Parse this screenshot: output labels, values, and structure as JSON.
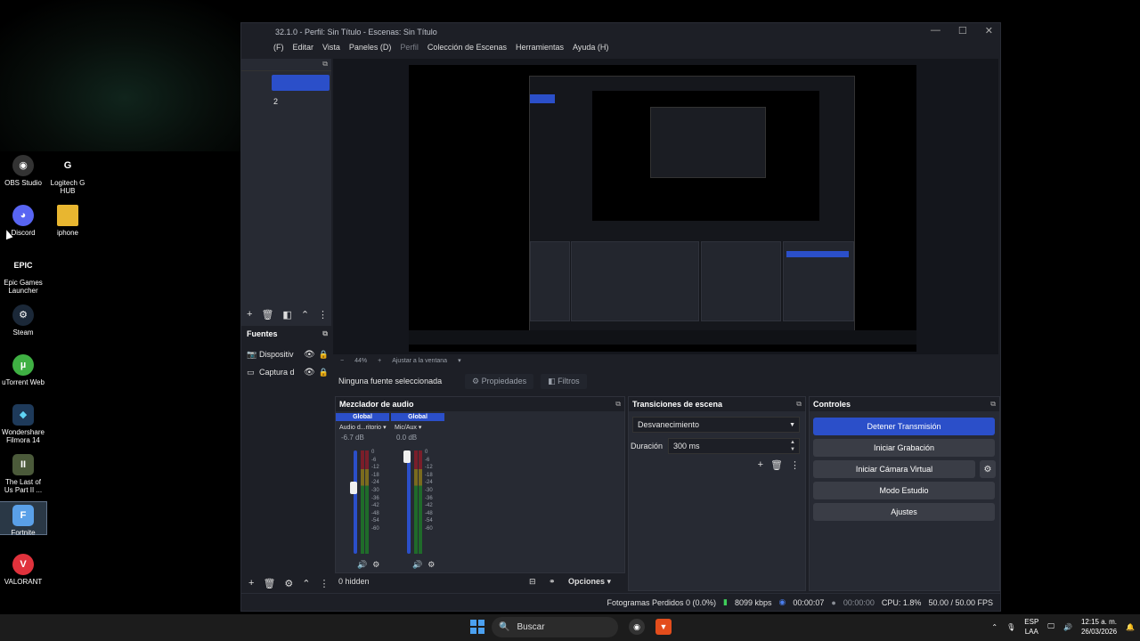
{
  "desktop": {
    "icons": [
      {
        "label": "OBS Studio"
      },
      {
        "label": "Logitech G HUB"
      },
      {
        "label": "Discord"
      },
      {
        "label": "iphone"
      },
      {
        "label": "Epic Games Launcher"
      },
      {
        "label": "Steam"
      },
      {
        "label": "uTorrent Web"
      },
      {
        "label": "Wondershare Filmora 14"
      },
      {
        "label": "The Last of Us Part II ..."
      },
      {
        "label": "Fortnite"
      },
      {
        "label": "VALORANT"
      }
    ]
  },
  "obs": {
    "title": "32.1.0 - Perfil: Sin Título - Escenas: Sin Título",
    "menu": [
      "(F)",
      "Editar",
      "Vista",
      "Paneles (D)",
      "Perfil",
      "Colección de Escenas",
      "Herramientas",
      "Ayuda (H)"
    ],
    "scenes": {
      "item2": "2"
    },
    "zoom": {
      "percent": "44%",
      "fit": "Ajustar a la ventana"
    },
    "sources": {
      "title": "Fuentes",
      "items": [
        {
          "label": "Dispositiv"
        },
        {
          "label": "Captura d"
        }
      ],
      "hidden_count": "0 hidden"
    },
    "props_bar": {
      "no_source": "Ninguna fuente seleccionada",
      "properties": "Propiedades",
      "filters": "Filtros"
    },
    "mixer": {
      "title": "Mezclador de audio",
      "channels": [
        {
          "tag": "Global",
          "name": "Audio d...ritorio",
          "db": "-6.7 dB",
          "level": 0.66
        },
        {
          "tag": "Global",
          "name": "Mic/Aux",
          "db": "0.0 dB",
          "level": 1.0
        }
      ],
      "scale": [
        "0",
        "-6",
        "-12",
        "-18",
        "-24",
        "-30",
        "-36",
        "-42",
        "-48",
        "-54",
        "-60"
      ]
    },
    "transitions": {
      "title": "Transiciones de escena",
      "selected": "Desvanecimiento",
      "duration_label": "Duración",
      "duration_value": "300 ms"
    },
    "controls": {
      "title": "Controles",
      "stop_stream": "Detener Transmisión",
      "start_recording": "Iniciar Grabación",
      "start_virtual_cam": "Iniciar Cámara Virtual",
      "studio_mode": "Modo Estudio",
      "settings": "Ajustes"
    },
    "options_label": "Opciones",
    "status": {
      "dropped": "Fotogramas Perdidos 0 (0.0%)",
      "bitrate": "8099 kbps",
      "stream_time": "00:00:07",
      "rec_time": "00:00:00",
      "cpu": "CPU: 1.8%",
      "fps": "50.00 / 50.00 FPS"
    }
  },
  "taskbar": {
    "search_label": "Buscar",
    "lang_top": "ESP",
    "lang_bottom": "LAA",
    "time": "12:15 a. m.",
    "date": "26/03/2026"
  },
  "colors": {
    "accent": "#2b4fc9",
    "panel": "#272a33",
    "bg": "#1d1f26"
  }
}
